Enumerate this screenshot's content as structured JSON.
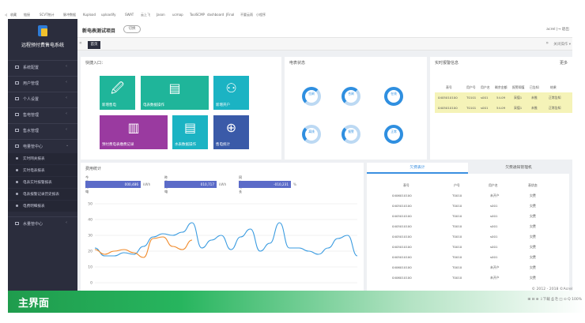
{
  "bookmarks": [
    "收藏",
    "链接",
    "SCVT统计",
    "脉冲数据",
    "Kupload",
    "uploadify",
    "SWAT",
    "云上飞",
    "Jason",
    "ucmap",
    "ToolSCMP",
    "dashboard",
    "JFinal",
    "不要云雨",
    "小程序"
  ],
  "sidebar": {
    "app_name": "远程预付费售电系统",
    "items": [
      {
        "label": "系统配置"
      },
      {
        "label": "用户管理"
      },
      {
        "label": "个人设置"
      },
      {
        "label": "售电管理"
      },
      {
        "label": "售水管理"
      },
      {
        "label": "电量管中心"
      }
    ],
    "subitems": [
      "实时网关报表",
      "实时电表报表",
      "电表实时报警报表",
      "电表报警记录历史报表",
      "电费明细报表"
    ],
    "item_after": {
      "label": "水量管中心"
    }
  },
  "header": {
    "title": "新电表测试项目",
    "switch_label": "切换",
    "user_label": "acrel  |→ 退出"
  },
  "tabs": {
    "home_label": "首页",
    "close_label": "关闭操作 ▾"
  },
  "quick": {
    "title": "快捷入口：",
    "tiles": [
      {
        "label": "新增售电",
        "icon": "🖉",
        "color": "#1fb59a"
      },
      {
        "label": "电表数据操作",
        "icon": "▤",
        "color": "#5b6bc8"
      },
      {
        "label": "新增开户",
        "icon": "⚇",
        "color": "#1fb59a"
      },
      {
        "label": "预付费电表缴费记录",
        "icon": "▥",
        "color": "#9a3aa0"
      },
      {
        "label": "水表数据操作",
        "icon": "▤",
        "color": "#1bb3c3"
      },
      {
        "label": "售电统计",
        "icon": "⊕",
        "color": "#3a5aa8"
      }
    ]
  },
  "meter_status": {
    "title": "电表状态",
    "rings": [
      {
        "label": "拉闸"
      },
      {
        "label": "合闸"
      },
      {
        "label": "在线"
      },
      {
        "label": "离线"
      },
      {
        "label": "报警"
      },
      {
        "label": "正常"
      }
    ]
  },
  "alarm": {
    "title": "实时报警信息",
    "more": "更多",
    "headers": [
      "表号",
      "用户号",
      "用户名",
      "剩余金额",
      "报警阈值",
      "已告知",
      "结果"
    ],
    "rows": [
      [
        "0405010100",
        "T0101",
        "s001",
        "54.09",
        "采值1",
        "未推",
        "正常告知"
      ],
      [
        "0405010100",
        "T0101",
        "s001",
        "54.09",
        "采值1",
        "未推",
        "正常告知"
      ]
    ]
  },
  "stats": {
    "title": "费用统计",
    "items": [
      {
        "key": "今日用电",
        "value": "000,486",
        "unit": "kWh"
      },
      {
        "key": "昨日用电",
        "value": "010,717",
        "unit": "kWh"
      },
      {
        "key": "同比增长",
        "value": "-010,231",
        "unit": "%"
      }
    ]
  },
  "tabs2": {
    "tab1": "欠费表计",
    "tab2": "欠费通知管理机"
  },
  "arrears": {
    "headers": [
      "表号",
      "户号",
      "用户名",
      "表状态"
    ],
    "rows": [
      [
        "0406010100",
        "T0010",
        "未开户",
        "欠费"
      ],
      [
        "0405010100",
        "T0010",
        "s001",
        "欠费"
      ],
      [
        "0405010100",
        "T0010",
        "s001",
        "欠费"
      ],
      [
        "0405010100",
        "T0010",
        "s001",
        "欠费"
      ],
      [
        "0405010100",
        "T0010",
        "s001",
        "欠费"
      ],
      [
        "0405010100",
        "T0010",
        "s001",
        "欠费"
      ],
      [
        "0405010100",
        "T0010",
        "s001",
        "欠费"
      ],
      [
        "0406010100",
        "T0010",
        "未开户",
        "欠费"
      ],
      [
        "0406010100",
        "T0010",
        "未开户",
        "欠费"
      ]
    ]
  },
  "chart_data": {
    "type": "line",
    "ylim": [
      0,
      50
    ],
    "yticks": [
      0,
      10,
      20,
      30,
      40,
      50
    ],
    "series": [
      {
        "color": "#3a9be0",
        "values": [
          22,
          17,
          17,
          19,
          18,
          23,
          29,
          31,
          30,
          32,
          38,
          22,
          27,
          30,
          21,
          29,
          34,
          20,
          25,
          38,
          22,
          22,
          20,
          18,
          22,
          28,
          30,
          17
        ]
      },
      {
        "color": "#f08a2a",
        "values": [
          21,
          18,
          20,
          21,
          19,
          16,
          28,
          29,
          23,
          21,
          27
        ]
      }
    ]
  },
  "footer": {
    "banner": "主界面",
    "copyright": "© 2012 - 2018 ©Acrel",
    "toolbar": "⊞  ⊟  ⊕  ⇩下载  ⎙  ⎘  ◫  ⊙  Q 100%"
  }
}
